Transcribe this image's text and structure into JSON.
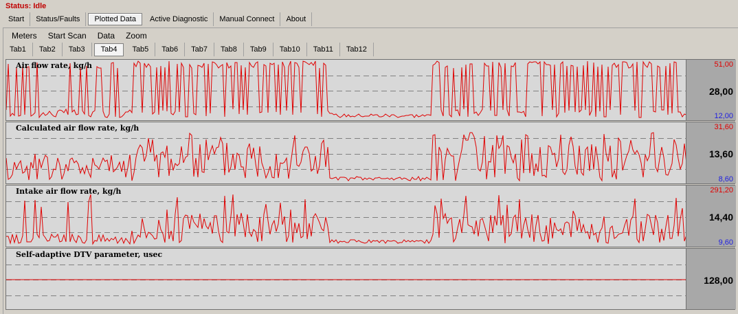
{
  "status": {
    "label": "Status: Idle"
  },
  "main_tabs": [
    {
      "label": "Start"
    },
    {
      "label": "Status/Faults"
    },
    {
      "label": "Plotted Data",
      "active": true
    },
    {
      "label": "Active Diagnostic"
    },
    {
      "label": "Manual Connect"
    },
    {
      "label": "About"
    }
  ],
  "menu": [
    {
      "label": "Meters"
    },
    {
      "label": "Start Scan"
    },
    {
      "label": "Data"
    },
    {
      "label": "Zoom"
    }
  ],
  "sub_tabs": [
    {
      "label": "Tab1"
    },
    {
      "label": "Tab2"
    },
    {
      "label": "Tab3"
    },
    {
      "label": "Tab4",
      "active": true
    },
    {
      "label": "Tab5"
    },
    {
      "label": "Tab6"
    },
    {
      "label": "Tab7"
    },
    {
      "label": "Tab8"
    },
    {
      "label": "Tab9"
    },
    {
      "label": "Tab10"
    },
    {
      "label": "Tab11"
    },
    {
      "label": "Tab12"
    }
  ],
  "colors": {
    "trace": "#e00000",
    "max": "#e00000",
    "min": "#2020e0",
    "grid": "#808080"
  },
  "panels": [
    {
      "title": "Air flow rate, kg/h",
      "max": "51,00",
      "current": "28,00",
      "min": "12,00"
    },
    {
      "title": "Calculated air flow rate, kg/h",
      "max": "31,60",
      "current": "13,60",
      "min": "8,60"
    },
    {
      "title": "Intake air flow rate, kg/h",
      "max": "291,20",
      "current": "14,40",
      "min": "9,60"
    },
    {
      "title": "Self-adaptive DTV parameter, usec",
      "max": "",
      "current": "128,00",
      "min": ""
    }
  ]
}
